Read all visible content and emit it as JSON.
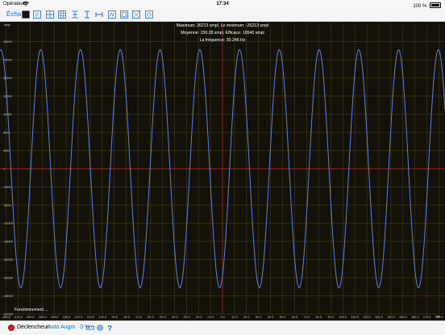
{
  "status_bar": {
    "carrier": "Opérateur",
    "time": "17:34",
    "battery": "100 %"
  },
  "toolbar": {
    "scale_label": "Écha",
    "tools": [
      "color-swatch-icon",
      "zoom-fit-icon",
      "grid-icon",
      "grid-large-icon",
      "trigger-icon",
      "cursor-vertical-icon",
      "cursor-horizontal-icon",
      "measure-icon",
      "frame-icon",
      "box-icon",
      "crop-icon"
    ]
  },
  "scope": {
    "stats_line1": "Maximum: 26213 smpl, Le minimum: -26213 smpl",
    "stats_line2": "Moyenne: 159.28 smpl, Efficace: 18540 smpl",
    "stats_line3": "La fréquence: 30.246 Hz",
    "status": "Fonctionnement ...",
    "y_unit": "smpl",
    "x_unit": "ms",
    "y_ticks": [
      "28000",
      "24000",
      "20000",
      "16000",
      "12000",
      "8000",
      "4000",
      "0",
      "-4000",
      "-8000",
      "-12000",
      "-16000",
      "-20000",
      "-24000",
      "-28000",
      "-32000"
    ],
    "x_ticks": [
      "-180.0",
      "-170.0",
      "-160.0",
      "-150.0",
      "-140.0",
      "-130.0",
      "-120.0",
      "-110.0",
      "-100.0",
      "-90.0",
      "-80.0",
      "-70.0",
      "-60.0",
      "-50.0",
      "-40.0",
      "-30.0",
      "-20.0",
      "-10.0",
      "0.0",
      "10.0",
      "20.0",
      "30.0",
      "40.0",
      "50.0",
      "60.0",
      "70.0",
      "80.0",
      "90.0",
      "100.0",
      "110.0",
      "120.0",
      "130.0",
      "140.0",
      "150.0",
      "160.0",
      "170.0",
      "180.0"
    ],
    "colors": {
      "trace": "#5a7fe0",
      "grid": "#4a4420",
      "axis": "#c02020",
      "background": "#141208",
      "text": "#ffffff",
      "tick_text": "#c8c8c8"
    }
  },
  "chart_data": {
    "type": "line",
    "title": "",
    "xlabel": "ms",
    "ylabel": "smpl",
    "xlim": [
      -185,
      185
    ],
    "ylim": [
      -32000,
      32000
    ],
    "series": [
      {
        "waveform": "sine",
        "amplitude": 26213,
        "frequency_hz": 30.246
      }
    ],
    "grid": true
  },
  "bottom_bar": {
    "trigger_label": "Déclencheur:",
    "trigger_value": "Auto Augm",
    "trigger_level": "0 %"
  }
}
